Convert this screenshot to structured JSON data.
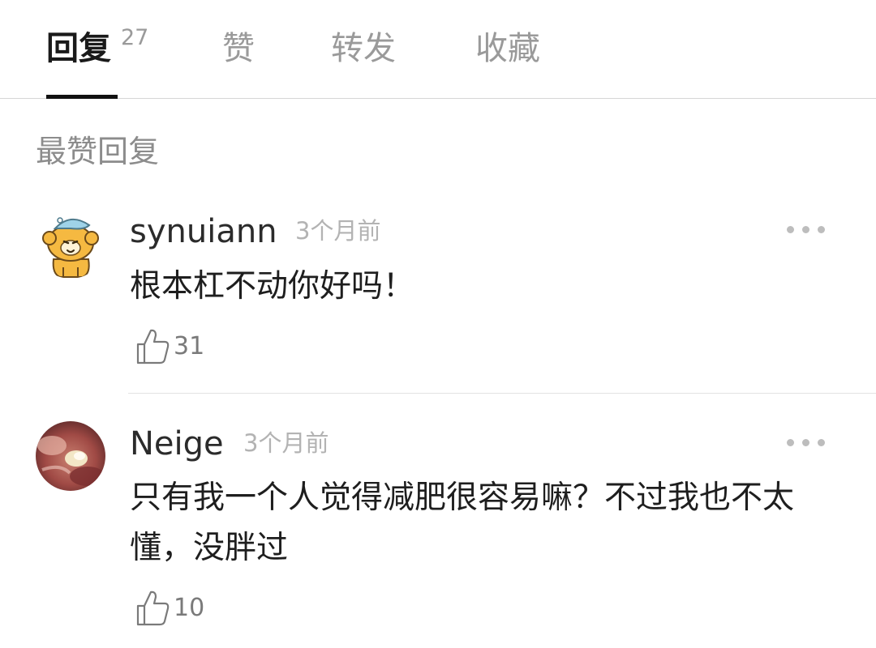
{
  "tabs": [
    {
      "label": "回复",
      "count": "27"
    },
    {
      "label": "赞"
    },
    {
      "label": "转发"
    },
    {
      "label": "收藏"
    }
  ],
  "section_title": "最赞回复",
  "comments": [
    {
      "username": "synuiann",
      "time": "3个月前",
      "text": "根本杠不动你好吗！",
      "likes": "31",
      "avatar_icon": "cartoon-bear-with-cap-avatar"
    },
    {
      "username": "Neige",
      "time": "3个月前",
      "text": "只有我一个人觉得减肥很容易嘛？不过我也不太懂，没胖过",
      "likes": "10",
      "avatar_icon": "food-photo-avatar"
    }
  ],
  "icons": {
    "more": "more-dots-icon",
    "like": "thumbs-up-icon"
  },
  "colors": {
    "active_tab": "#1a1a1a",
    "inactive_tab": "#9a9a9a",
    "indicator": "#111111",
    "meta_text": "#b3b3b3"
  }
}
